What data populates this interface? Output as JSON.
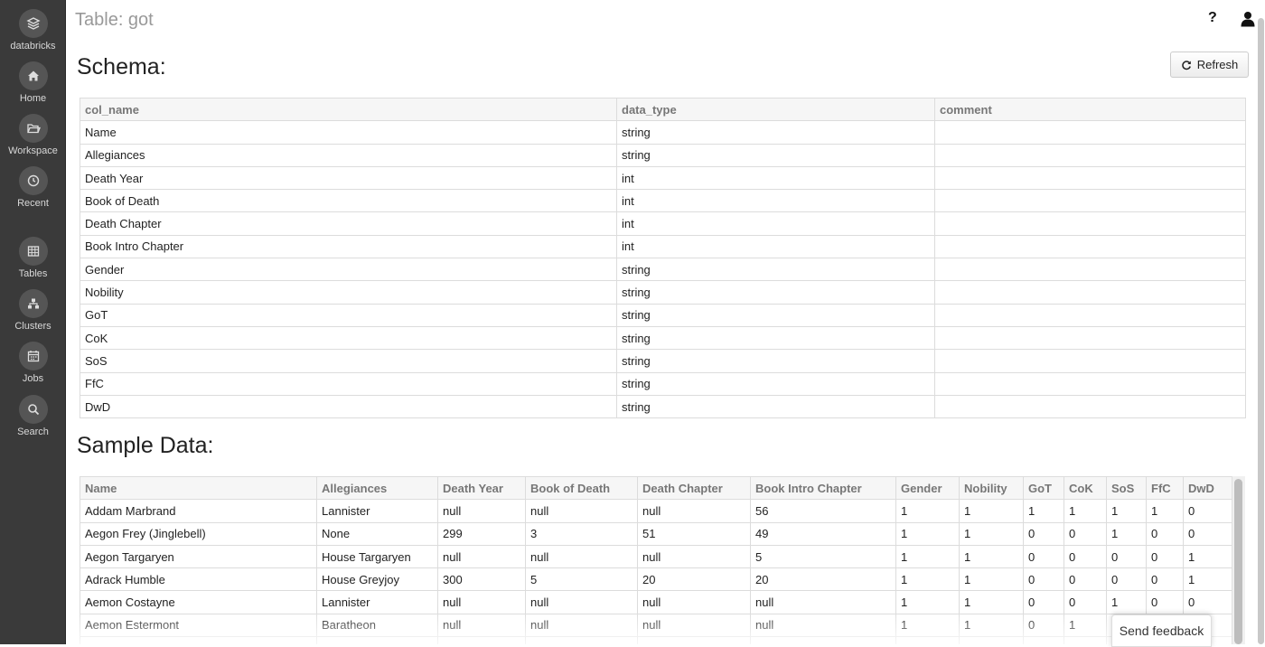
{
  "sidebar": {
    "items": [
      {
        "label": "databricks",
        "icon": "databricks-logo-icon"
      },
      {
        "label": "Home",
        "icon": "home-icon"
      },
      {
        "label": "Workspace",
        "icon": "folder-icon"
      },
      {
        "label": "Recent",
        "icon": "clock-icon"
      },
      {
        "label": "Tables",
        "icon": "table-icon"
      },
      {
        "label": "Clusters",
        "icon": "clusters-icon"
      },
      {
        "label": "Jobs",
        "icon": "calendar-icon"
      },
      {
        "label": "Search",
        "icon": "search-icon"
      }
    ]
  },
  "header": {
    "title": "Table: got",
    "help": "?"
  },
  "schema": {
    "heading": "Schema:",
    "refresh_label": "Refresh",
    "columns": [
      "col_name",
      "data_type",
      "comment"
    ],
    "rows": [
      [
        "Name",
        "string",
        ""
      ],
      [
        "Allegiances",
        "string",
        ""
      ],
      [
        "Death Year",
        "int",
        ""
      ],
      [
        "Book of Death",
        "int",
        ""
      ],
      [
        "Death Chapter",
        "int",
        ""
      ],
      [
        "Book Intro Chapter",
        "int",
        ""
      ],
      [
        "Gender",
        "string",
        ""
      ],
      [
        "Nobility",
        "string",
        ""
      ],
      [
        "GoT",
        "string",
        ""
      ],
      [
        "CoK",
        "string",
        ""
      ],
      [
        "SoS",
        "string",
        ""
      ],
      [
        "FfC",
        "string",
        ""
      ],
      [
        "DwD",
        "string",
        ""
      ]
    ]
  },
  "sample": {
    "heading": "Sample Data:",
    "columns": [
      "Name",
      "Allegiances",
      "Death Year",
      "Book of Death",
      "Death Chapter",
      "Book Intro Chapter",
      "Gender",
      "Nobility",
      "GoT",
      "CoK",
      "SoS",
      "FfC",
      "DwD"
    ],
    "rows": [
      [
        "Addam Marbrand",
        "Lannister",
        "null",
        "null",
        "null",
        "56",
        "1",
        "1",
        "1",
        "1",
        "1",
        "1",
        "0"
      ],
      [
        "Aegon Frey (Jinglebell)",
        "None",
        "299",
        "3",
        "51",
        "49",
        "1",
        "1",
        "0",
        "0",
        "1",
        "0",
        "0"
      ],
      [
        "Aegon Targaryen",
        "House Targaryen",
        "null",
        "null",
        "null",
        "5",
        "1",
        "1",
        "0",
        "0",
        "0",
        "0",
        "1"
      ],
      [
        "Adrack Humble",
        "House Greyjoy",
        "300",
        "5",
        "20",
        "20",
        "1",
        "1",
        "0",
        "0",
        "0",
        "0",
        "1"
      ],
      [
        "Aemon Costayne",
        "Lannister",
        "null",
        "null",
        "null",
        "null",
        "1",
        "1",
        "0",
        "0",
        "1",
        "0",
        "0"
      ],
      [
        "Aemon Estermont",
        "Baratheon",
        "null",
        "null",
        "null",
        "null",
        "1",
        "1",
        "0",
        "1",
        "",
        "",
        ""
      ]
    ]
  },
  "feedback_label": "Send feedback"
}
